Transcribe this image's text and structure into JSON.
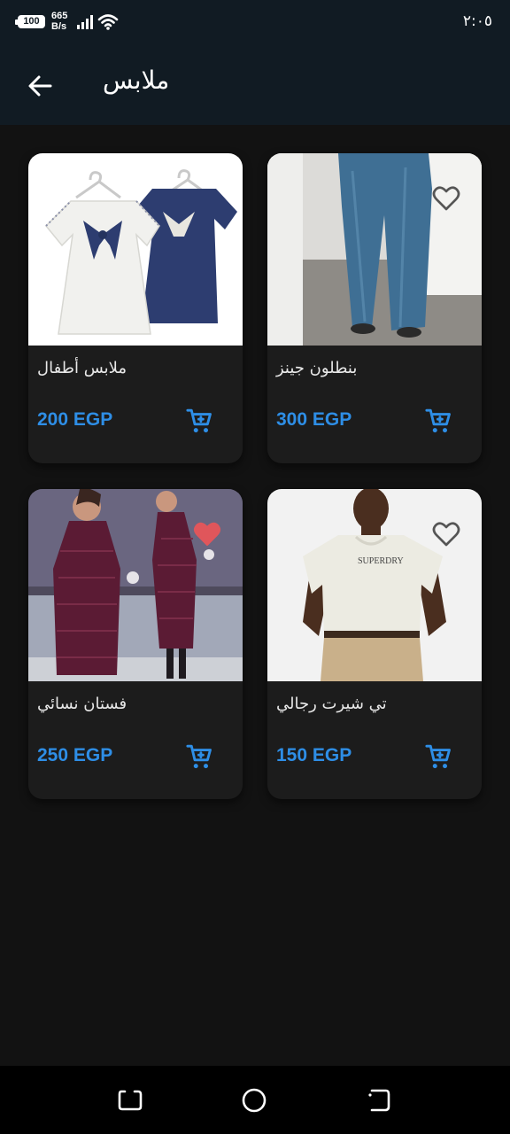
{
  "status_bar": {
    "battery": "100",
    "net_speed_value": "665",
    "net_speed_unit": "B/s",
    "time": "٢:٠٥",
    "icons": [
      "battery-icon",
      "signal-icon",
      "wifi-icon"
    ]
  },
  "app_bar": {
    "title": "ملابس",
    "back_icon": "arrow-back-icon"
  },
  "products": [
    {
      "name": "ملابس أطفال",
      "price": "200 EGP",
      "favorite": false,
      "image": "kids-dresses"
    },
    {
      "name": "بنطلون جينز",
      "price": "300 EGP",
      "favorite": false,
      "image": "jeans"
    },
    {
      "name": "فستان نسائي",
      "price": "250 EGP",
      "favorite": true,
      "image": "women-coat"
    },
    {
      "name": "تي شيرت رجالي",
      "price": "150 EGP",
      "favorite": false,
      "image": "men-tshirt"
    }
  ],
  "nav_bar": {
    "icons": [
      "recents-icon",
      "home-icon",
      "back-nav-icon"
    ]
  },
  "colors": {
    "app_bar_bg": "#111b23",
    "page_bg": "#121212",
    "card_bg": "#1c1c1c",
    "accent": "#2e8ee6",
    "favorite_active": "#e0565b"
  }
}
